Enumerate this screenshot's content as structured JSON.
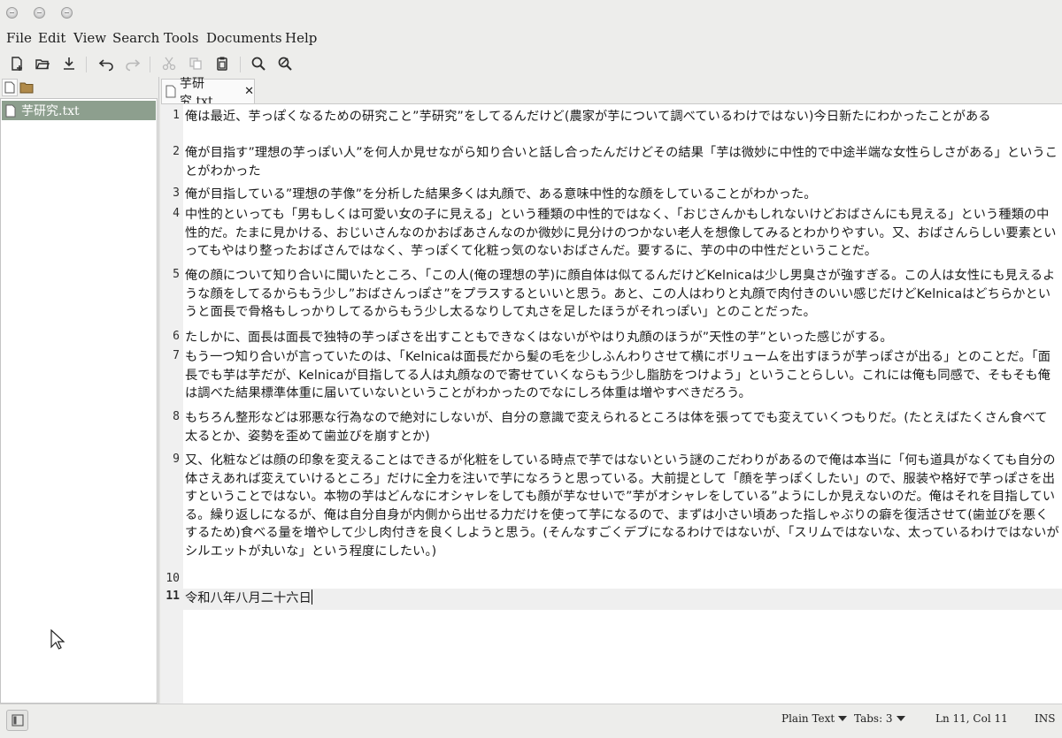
{
  "menu": [
    "File",
    "Edit",
    "View",
    "Search",
    "Tools",
    "Documents",
    "Help"
  ],
  "toolbar_icons": [
    "new-document-icon",
    "open-folder-icon",
    "save-download-icon",
    "undo-icon",
    "redo-icon",
    "cut-icon",
    "copy-icon",
    "paste-icon",
    "search-icon",
    "search-replace-icon"
  ],
  "side_panel": {
    "file": "芋研究.txt"
  },
  "tab": {
    "title": "芋研究.txt",
    "close": "✕"
  },
  "editor": {
    "lines": [
      {
        "num": "1",
        "text": "俺は最近、芋っぽくなるための研究こと”芋研究”をしてるんだけど(農家が芋について調べているわけではない)今日新たにわかったことがある"
      },
      {
        "num": "2",
        "text": "俺が目指す”理想の芋っぽい人”を何人か見せながら知り合いと話し合ったんだけどその結果「芋は微妙に中性的で中途半端な女性らしさがある」ということがわかった"
      },
      {
        "num": "3",
        "text": "俺が目指している”理想の芋像”を分析した結果多くは丸顔で、ある意味中性的な顔をしていることがわかった。"
      },
      {
        "num": "4",
        "text": "中性的といっても「男もしくは可愛い女の子に見える」という種類の中性的ではなく、「おじさんかもしれないけどおばさんにも見える」という種類の中性的だ。たまに見かける、おじいさんなのかおばあさんなのか微妙に見分けのつかない老人を想像してみるとわかりやすい。又、おばさんらしい要素といってもやはり整ったおばさんではなく、芋っぽくて化粧っ気のないおばさんだ。要するに、芋の中の中性だということだ。"
      },
      {
        "num": "5",
        "text": "俺の顔について知り合いに聞いたところ、「この人(俺の理想の芋)に顔自体は似てるんだけどKelnicaは少し男臭さが強すぎる。この人は女性にも見えるような顔をしてるからもう少し”おばさんっぽさ”をプラスするといいと思う。あと、この人はわりと丸顔で肉付きのいい感じだけどKelnicaはどちらかというと面長で骨格もしっかりしてるからもう少し太るなりして丸さを足したほうがそれっぽい」とのことだった。"
      },
      {
        "num": "6",
        "text": "たしかに、面長は面長で独特の芋っぽさを出すこともできなくはないがやはり丸顔のほうが”天性の芋”といった感じがする。"
      },
      {
        "num": "7",
        "text": "もう一つ知り合いが言っていたのは、「Kelnicaは面長だから髪の毛を少しふんわりさせて横にボリュームを出すほうが芋っぽさが出る」とのことだ。「面長でも芋は芋だが、Kelnicaが目指してる人は丸顔なので寄せていくならもう少し脂肪をつけよう」ということらしい。これには俺も同感で、そもそも俺は調べた結果標準体重に届いていないということがわかったのでなにしろ体重は増やすべきだろう。"
      },
      {
        "num": "8",
        "text": "もちろん整形などは邪悪な行為なので絶対にしないが、自分の意識で変えられるところは体を張ってでも変えていくつもりだ。(たとえばたくさん食べて太るとか、姿勢を歪めて歯並びを崩すとか)"
      },
      {
        "num": "9",
        "text": "又、化粧などは顔の印象を変えることはできるが化粧をしている時点で芋ではないという謎のこだわりがあるので俺は本当に「何も道具がなくても自分の体さえあれば変えていけるところ」だけに全力を注いで芋になろうと思っている。大前提として「顔を芋っぽくしたい」ので、服装や格好で芋っぽさを出すということではない。本物の芋はどんなにオシャレをしても顔が芋なせいで”芋がオシャレをしている”ようにしか見えないのだ。俺はそれを目指している。繰り返しになるが、俺は自分自身が内側から出せる力だけを使って芋になるので、まずは小さい頃あった指しゃぶりの癖を復活させて(歯並びを悪くするため)食べる量を増やして少し肉付きを良くしようと思う。(そんなすごくデブになるわけではないが、「スリムではないな、太っているわけではないがシルエットが丸いな」という程度にしたい。)"
      },
      {
        "num": "10",
        "text": ""
      },
      {
        "num": "11",
        "text": "令和八年八月二十六日"
      }
    ]
  },
  "status": {
    "language": "Plain Text",
    "tabs": "Tabs: 3",
    "position": "Ln 11, Col 11",
    "mode": "INS"
  }
}
